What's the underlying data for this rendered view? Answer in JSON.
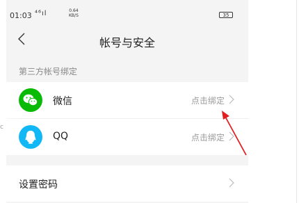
{
  "status": {
    "time": "01:03",
    "signal": "⁴⁶ıl",
    "speed_value": "0.64",
    "speed_unit": "KB/S",
    "battery": "35"
  },
  "nav": {
    "title": "帐号与安全"
  },
  "section": {
    "header": "第三方帐号绑定"
  },
  "accounts": [
    {
      "name": "微信",
      "action": "点击绑定",
      "icon": "wechat-icon",
      "color": "#09bb07"
    },
    {
      "name": "QQ",
      "action": "点击绑定",
      "icon": "qq-icon",
      "color": "#12b7f5"
    }
  ],
  "password": {
    "label": "设置密码"
  },
  "side_mark": "c"
}
